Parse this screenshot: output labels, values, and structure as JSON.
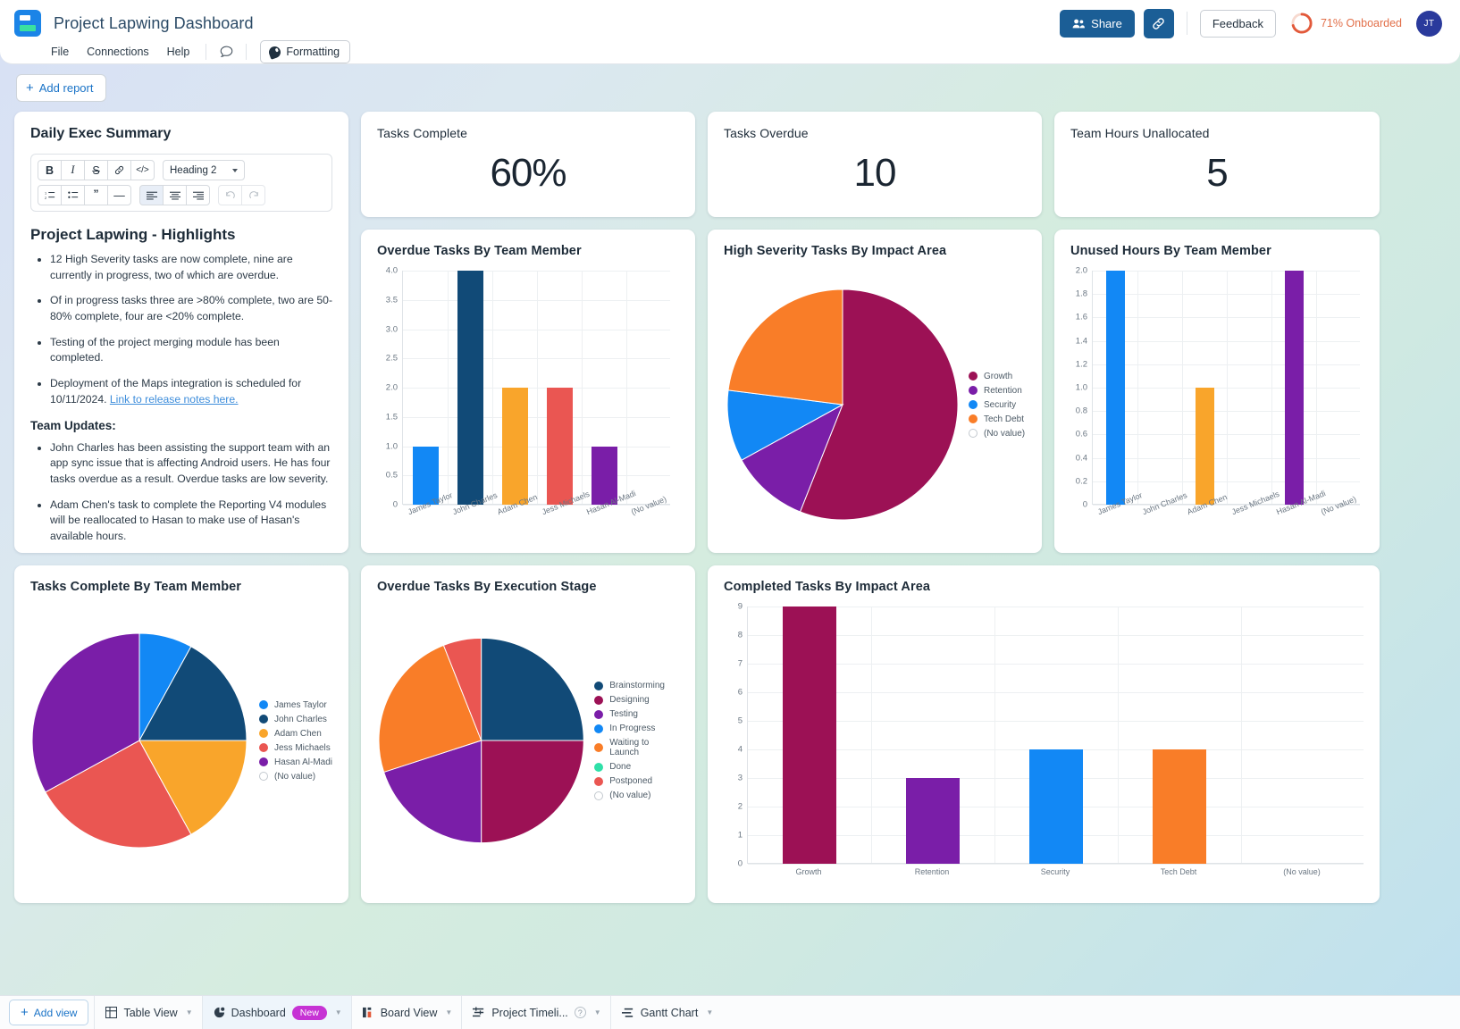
{
  "header": {
    "app_title": "Project Lapwing Dashboard",
    "logo_icon": "dashboard-logo-icon",
    "menu": [
      "File",
      "Connections",
      "Help"
    ],
    "comment_icon": "comment-icon",
    "formatting_label": "Formatting",
    "formatting_icon": "palette-icon",
    "share_label": "Share",
    "share_icon": "people-icon",
    "link_icon": "link-icon",
    "feedback_label": "Feedback",
    "onboard_text": "71% Onboarded",
    "onboard_percent": 71,
    "onboard_color": "#e2704a",
    "avatar_initials": "JT",
    "add_report_label": "Add report"
  },
  "exec_summary": {
    "card_title": "Daily Exec Summary",
    "toolbar": {
      "bold": "B",
      "italic": "I",
      "strikethrough": "S",
      "link": "link-icon",
      "code": "</>",
      "heading_select": "Heading 2",
      "ordered_list": "ordered-list-icon",
      "bullet_list": "bullet-list-icon",
      "quote": "”",
      "divider": "—",
      "align_left": "align-left-icon",
      "align_center": "align-center-icon",
      "align_right": "align-right-icon",
      "undo": "undo-icon",
      "redo": "redo-icon"
    },
    "doc_heading": "Project Lapwing - Highlights",
    "bullets": [
      "12 High Severity tasks are now complete, nine are currently in progress, two of which are overdue.",
      "Of in progress tasks three are >80% complete,  two are    50-80% complete, four are <20% complete.",
      "Testing of the project merging module has been completed."
    ],
    "bullet_with_link": {
      "text": "Deployment of the Maps integration is scheduled for 10/11/2024. ",
      "link_text": "Link to release notes here."
    },
    "subheading": "Team Updates:",
    "team_updates": [
      "John Charles has been assisting the support team with an app sync issue that is affecting Android users. He has four tasks overdue as a result. Overdue tasks are low severity.",
      "Adam Chen's task to complete the Reporting V4 modules will be reallocated to Hasan to make use of Hasan's available hours."
    ]
  },
  "kpis": [
    {
      "title": "Tasks Complete",
      "value": "60%"
    },
    {
      "title": "Tasks Overdue",
      "value": "10"
    },
    {
      "title": "Team Hours Unallocated",
      "value": "5"
    }
  ],
  "chart_data": [
    {
      "id": "overdue_by_member",
      "type": "bar",
      "title": "Overdue Tasks By Team Member",
      "categories": [
        "James Taylor",
        "John Charles",
        "Adam Chen",
        "Jess Michaels",
        "Hasan Al-Madi",
        "(No value)"
      ],
      "values": [
        1,
        4,
        2,
        2,
        1,
        0
      ],
      "colors": [
        "#1288f5",
        "#114a77",
        "#f9a52b",
        "#ea5652",
        "#7a1ea8",
        "#ffffff"
      ],
      "ylim": [
        0,
        4
      ],
      "yticks": [
        "0",
        "0.5",
        "1.0",
        "1.5",
        "2.0",
        "2.5",
        "3.0",
        "3.5",
        "4.0"
      ],
      "xlabel": "",
      "ylabel": "",
      "grid": true,
      "legend": "none"
    },
    {
      "id": "high_severity_by_impact",
      "type": "pie",
      "title": "High Severity Tasks By Impact Area",
      "categories": [
        "Growth",
        "Retention",
        "Security",
        "Tech Debt",
        "(No value)"
      ],
      "values": [
        56,
        11,
        10,
        23,
        0
      ],
      "colors": [
        "#9c1155",
        "#7a1ea8",
        "#1288f5",
        "#f97d28",
        "#ffffff"
      ],
      "legend": "right"
    },
    {
      "id": "unused_hours_by_member",
      "type": "bar",
      "title": "Unused Hours By Team Member",
      "categories": [
        "James Taylor",
        "John Charles",
        "Adam Chen",
        "Jess Michaels",
        "Hasan Al-Madi",
        "(No value)"
      ],
      "values": [
        2,
        0,
        1,
        0,
        2,
        0
      ],
      "colors": [
        "#1288f5",
        "#114a77",
        "#f9a52b",
        "#ea5652",
        "#7a1ea8",
        "#ffffff"
      ],
      "ylim": [
        0,
        2
      ],
      "yticks": [
        "0",
        "0.2",
        "0.4",
        "0.6",
        "0.8",
        "1.0",
        "1.2",
        "1.4",
        "1.6",
        "1.8",
        "2.0"
      ],
      "xlabel": "",
      "ylabel": "",
      "grid": true,
      "legend": "none"
    },
    {
      "id": "tasks_complete_by_member",
      "type": "pie",
      "title": "Tasks Complete By Team Member",
      "categories": [
        "James Taylor",
        "John Charles",
        "Adam Chen",
        "Jess Michaels",
        "Hasan Al-Madi",
        "(No value)"
      ],
      "values": [
        8,
        17,
        17,
        25,
        33,
        0
      ],
      "colors": [
        "#1288f5",
        "#114a77",
        "#f9a52b",
        "#ea5652",
        "#7a1ea8",
        "#ffffff"
      ],
      "legend": "right"
    },
    {
      "id": "overdue_by_stage",
      "type": "pie",
      "title": "Overdue Tasks By Execution Stage",
      "categories": [
        "Brainstorming",
        "Designing",
        "Testing",
        "In Progress",
        "Waiting to Launch",
        "Done",
        "Postponed",
        "(No value)"
      ],
      "values": [
        25,
        25,
        20,
        0,
        24,
        0,
        6,
        0
      ],
      "colors": [
        "#114a77",
        "#9c1155",
        "#7a1ea8",
        "#1288f5",
        "#f97d28",
        "#2fe0a8",
        "#ea5652",
        "#ffffff"
      ],
      "legend": "right"
    },
    {
      "id": "completed_by_impact",
      "type": "bar",
      "title": "Completed Tasks By Impact Area",
      "categories": [
        "Growth",
        "Retention",
        "Security",
        "Tech Debt",
        "(No value)"
      ],
      "values": [
        9,
        3,
        4,
        4,
        0
      ],
      "colors": [
        "#9c1155",
        "#7a1ea8",
        "#1288f5",
        "#f97d28",
        "#ffffff"
      ],
      "ylim": [
        0,
        9
      ],
      "yticks": [
        "0",
        "1",
        "2",
        "3",
        "4",
        "5",
        "6",
        "7",
        "8",
        "9"
      ],
      "xlabel": "",
      "ylabel": "",
      "grid": true,
      "legend": "none"
    }
  ],
  "tabbar": {
    "add_view_label": "Add view",
    "tabs": [
      {
        "label": "Table View",
        "icon": "table-icon",
        "active": false,
        "badge": null,
        "help": false
      },
      {
        "label": "Dashboard",
        "icon": "dashboard-icon",
        "active": true,
        "badge": "New",
        "help": false
      },
      {
        "label": "Board View",
        "icon": "board-icon",
        "active": false,
        "badge": null,
        "help": false
      },
      {
        "label": "Project Timeli...",
        "icon": "timeline-icon",
        "active": false,
        "badge": null,
        "help": true
      },
      {
        "label": "Gantt Chart",
        "icon": "gantt-icon",
        "active": false,
        "badge": null,
        "help": false
      }
    ]
  }
}
